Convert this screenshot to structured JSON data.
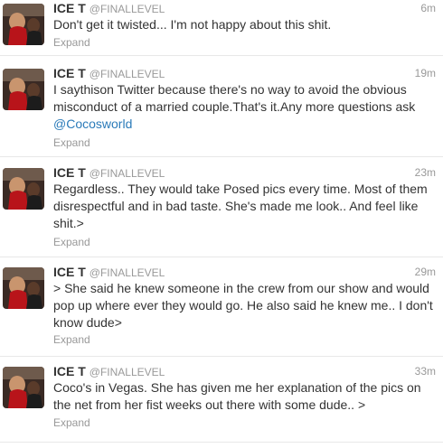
{
  "tweets": [
    {
      "name": "ICE T",
      "handle": "@FINALLEVEL",
      "time": "6m",
      "text": "Don't get it twisted... I'm not happy about this shit.",
      "expand": "Expand"
    },
    {
      "name": "ICE T",
      "handle": "@FINALLEVEL",
      "time": "19m",
      "text": "I saythison Twitter because there's no way to avoid the obvious misconduct of a married couple.That's it.Any more questions ask",
      "mention": "@Cocosworld",
      "expand": "Expand"
    },
    {
      "name": "ICE T",
      "handle": "@FINALLEVEL",
      "time": "23m",
      "text": "Regardless.. They would take Posed pics every time. Most of them disrespectful and in bad taste. She's made me look.. And feel like shit.>",
      "expand": "Expand"
    },
    {
      "name": "ICE T",
      "handle": "@FINALLEVEL",
      "time": "29m",
      "text": "> She said he knew someone in the crew from our show and would pop up where ever they would go. He also said he knew me.. I don't know dude>",
      "expand": "Expand"
    },
    {
      "name": "ICE T",
      "handle": "@FINALLEVEL",
      "time": "33m",
      "text": "Coco's in Vegas. She has given me her explanation of the pics on the net from her fist weeks out there with some dude.. >",
      "expand": "Expand"
    }
  ]
}
